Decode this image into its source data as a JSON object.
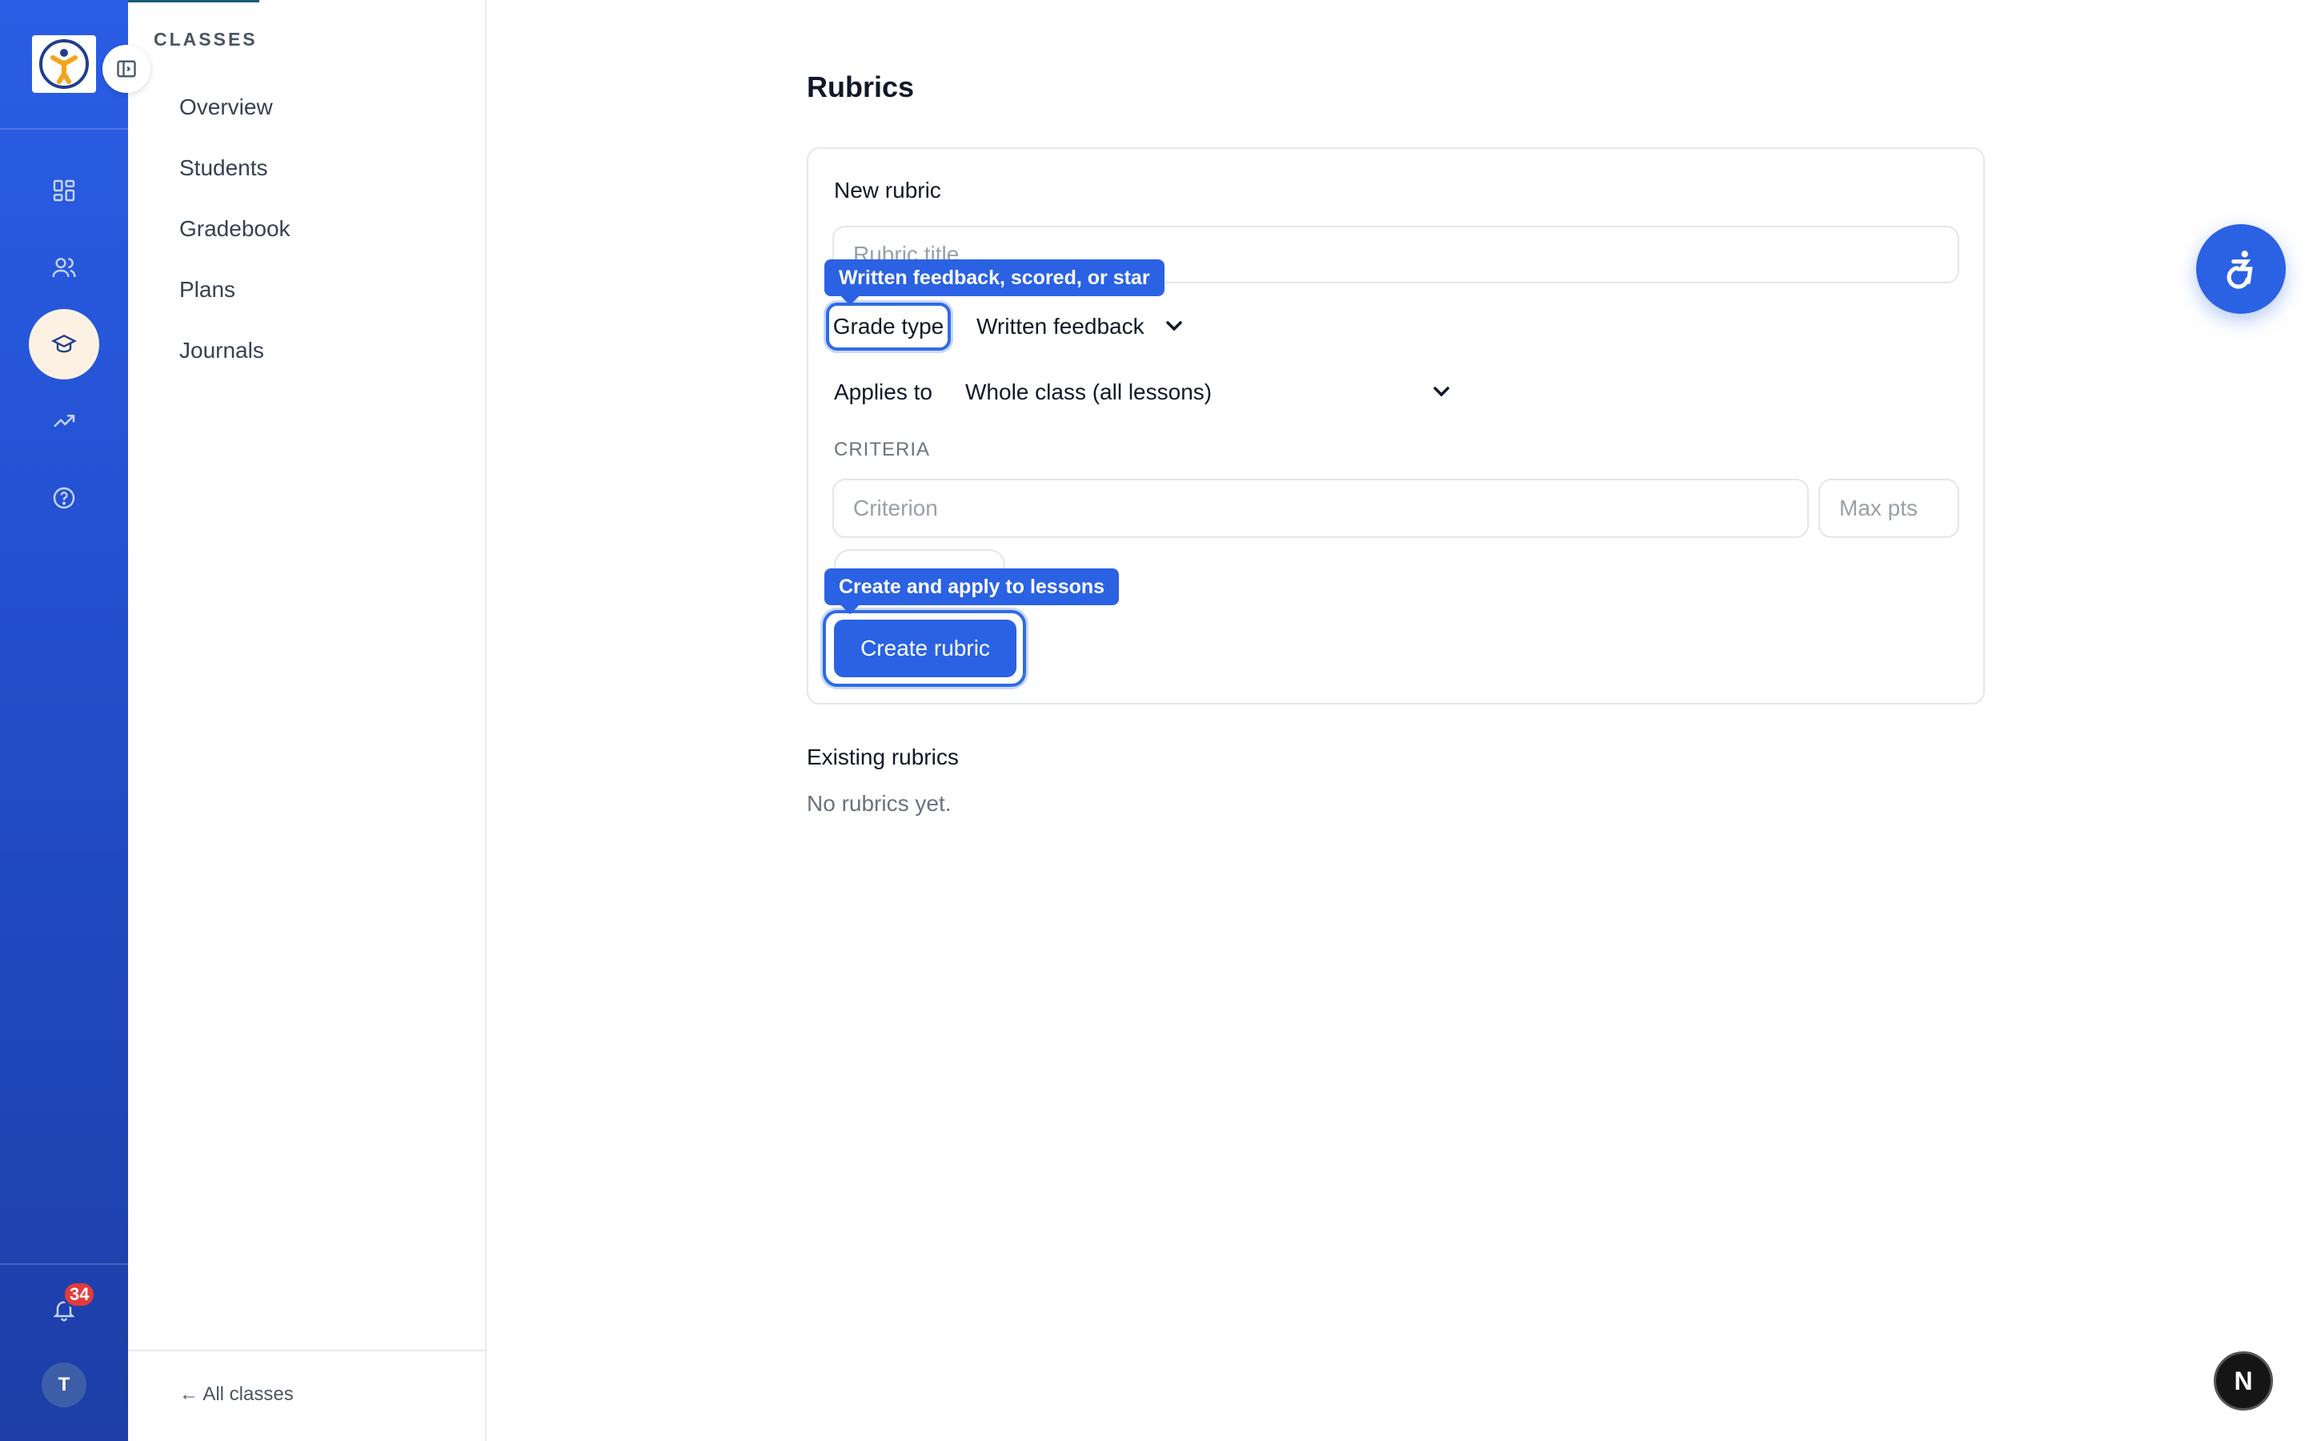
{
  "rail": {
    "logo_icon": "kid-logo",
    "collapse_icon": "sidebar-toggle-icon",
    "nav": [
      {
        "icon": "dashboard-icon",
        "active": false
      },
      {
        "icon": "people-icon",
        "active": false
      },
      {
        "icon": "graduation-cap-icon",
        "active": true
      },
      {
        "icon": "trend-up-icon",
        "active": false
      },
      {
        "icon": "help-circle-icon",
        "active": false
      }
    ],
    "notifications_count": "34",
    "avatar_initial": "T",
    "active_bg": "#fdf1e4"
  },
  "sidebar": {
    "heading": "CLASSES",
    "items": [
      {
        "label": "Overview"
      },
      {
        "label": "Students"
      },
      {
        "label": "Gradebook"
      },
      {
        "label": "Plans"
      },
      {
        "label": "Journals"
      }
    ],
    "back_link": "← All classes"
  },
  "main": {
    "title": "Rubrics",
    "new_rubric": {
      "heading": "New rubric",
      "title_placeholder": "Rubric title",
      "grade_type": {
        "label": "Grade type",
        "value": "Written feedback",
        "tooltip": "Written feedback, scored, or star"
      },
      "applies_to": {
        "label": "Applies to",
        "value": "Whole class (all lessons)"
      },
      "criteria_heading": "CRITERIA",
      "criterion_placeholder": "Criterion",
      "max_pts_placeholder": "Max pts",
      "create_button": "Create rubric",
      "create_tooltip": "Create and apply to lessons"
    },
    "existing": {
      "heading": "Existing rubrics",
      "empty_text": "No rubrics yet."
    }
  },
  "floating": {
    "accessibility_icon": "accessibility-icon",
    "dev_badge": "N"
  },
  "colors": {
    "accent": "#2b62e3",
    "rail_top": "#2a5ee6",
    "rail_bottom": "#1c3ea6",
    "badge": "#e23b3b"
  }
}
